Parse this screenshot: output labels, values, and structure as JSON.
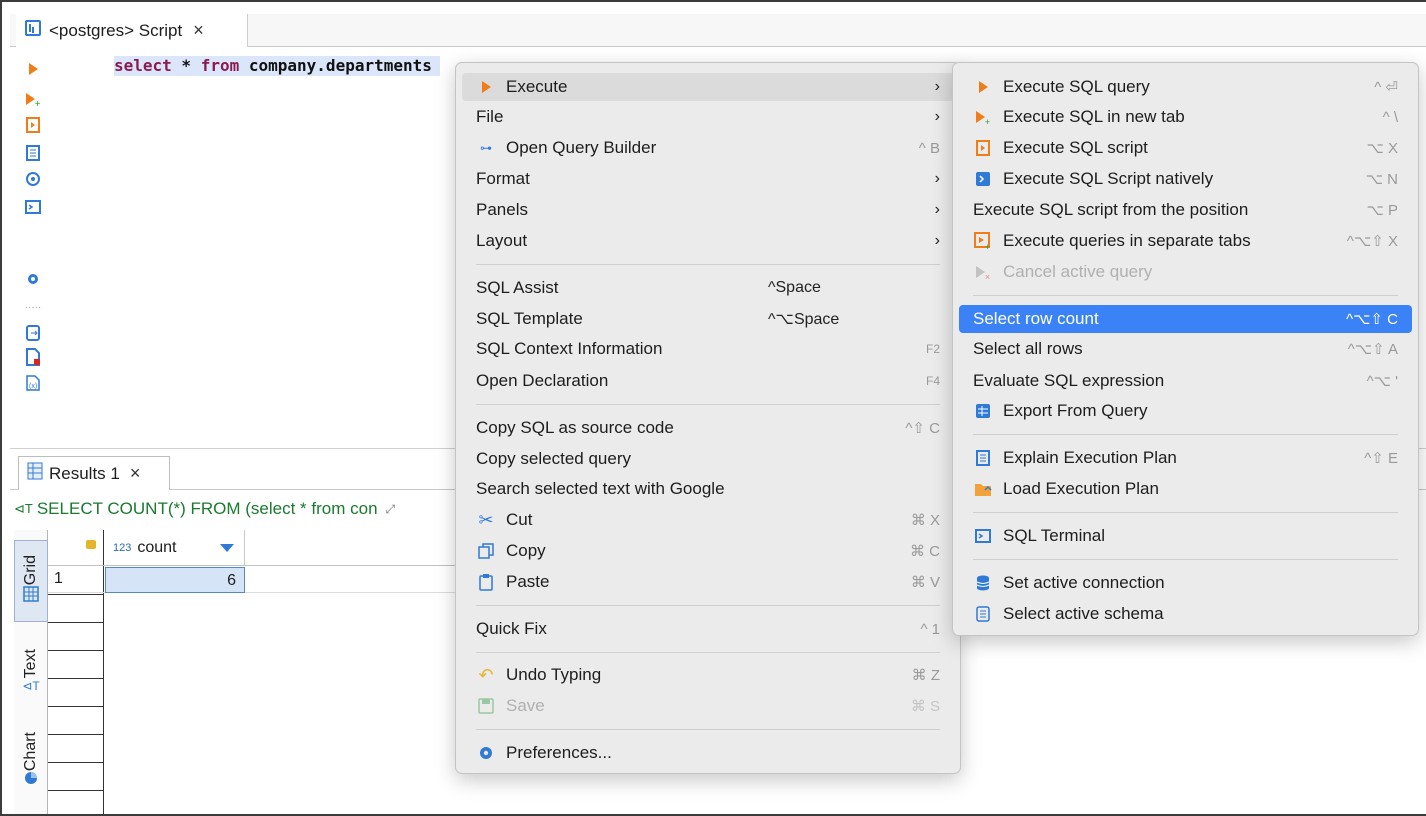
{
  "editor": {
    "tab_label": "<postgres> Script",
    "code": {
      "kw_select": "select",
      "star": " * ",
      "kw_from": "from",
      "rest": " company.departments"
    }
  },
  "results": {
    "tab_label": "Results 1",
    "filter_text": "SELECT COUNT(*) FROM (select * from con",
    "column_type": "123",
    "column_name": "count",
    "rows": [
      {
        "num": "1",
        "count": "6"
      }
    ],
    "side_tabs": [
      "Grid",
      "Text",
      "Chart"
    ]
  },
  "context_menu": {
    "execute": "Execute",
    "file": "File",
    "open_query_builder": "Open Query Builder",
    "open_query_builder_sc": "^ B",
    "format": "Format",
    "panels": "Panels",
    "layout": "Layout",
    "sql_assist": "SQL Assist",
    "sql_assist_sc": "^Space",
    "sql_template": "SQL Template",
    "sql_template_sc": "^⌥Space",
    "sql_context_info": "SQL Context Information",
    "sql_context_info_sc": "F2",
    "open_declaration": "Open Declaration",
    "open_declaration_sc": "F4",
    "copy_sql_source": "Copy SQL as source code",
    "copy_sql_source_sc": "^⇧ C",
    "copy_selected_query": "Copy selected query",
    "search_google": "Search selected text with Google",
    "cut": "Cut",
    "cut_sc": "⌘ X",
    "copy": "Copy",
    "copy_sc": "⌘ C",
    "paste": "Paste",
    "paste_sc": "⌘ V",
    "quick_fix": "Quick Fix",
    "quick_fix_sc": "^ 1",
    "undo_typing": "Undo Typing",
    "undo_typing_sc": "⌘ Z",
    "save": "Save",
    "save_sc": "⌘ S",
    "preferences": "Preferences..."
  },
  "execute_submenu": {
    "exec_query": "Execute SQL query",
    "exec_query_sc": "^ ⏎",
    "exec_new_tab": "Execute SQL in new tab",
    "exec_new_tab_sc": "^ \\",
    "exec_script": "Execute SQL script",
    "exec_script_sc": "⌥ X",
    "exec_natively": "Execute SQL Script natively",
    "exec_natively_sc": "⌥ N",
    "exec_from_pos": "Execute SQL script from the position",
    "exec_from_pos_sc": "⌥ P",
    "exec_separate": "Execute queries in separate tabs",
    "exec_separate_sc": "^⌥⇧ X",
    "cancel_query": "Cancel active query",
    "select_row_count": "Select row count",
    "select_row_count_sc": "^⌥⇧ C",
    "select_all_rows": "Select all rows",
    "select_all_rows_sc": "^⌥⇧ A",
    "eval_expr": "Evaluate SQL expression",
    "eval_expr_sc": "^⌥ '",
    "export_query": "Export From Query",
    "explain_plan": "Explain Execution Plan",
    "explain_plan_sc": "^⇧ E",
    "load_plan": "Load Execution Plan",
    "sql_terminal": "SQL Terminal",
    "set_connection": "Set active connection",
    "select_schema": "Select active schema"
  },
  "colors": {
    "accent": "#3b82f6",
    "execute_orange": "#ef7d1a",
    "filter_green": "#1a7a2e",
    "keyword": "#8a1b50"
  }
}
